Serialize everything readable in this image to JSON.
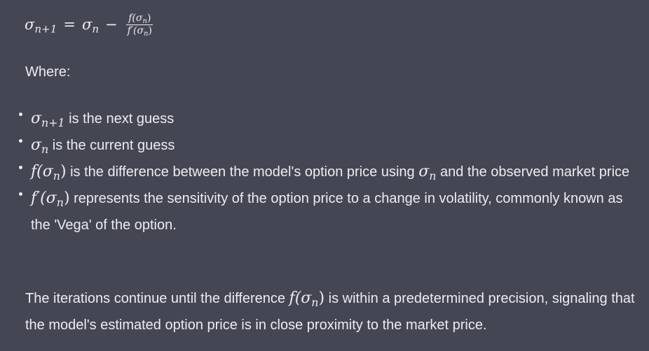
{
  "formula": {
    "lhs_symbol": "σ",
    "lhs_sub": "n+1",
    "equals": "=",
    "rhs_symbol": "σ",
    "rhs_sub": "n",
    "minus": "−",
    "numerator": "f(σ",
    "numerator_sub": "n",
    "numerator_close": ")",
    "denominator": "f′(σ",
    "denominator_sub": "n",
    "denominator_close": ")"
  },
  "where_label": "Where:",
  "bullets": [
    {
      "math_symbol": "σ",
      "math_sub": "n+1",
      "text": " is the next guess"
    },
    {
      "math_symbol": "σ",
      "math_sub": "n",
      "text": " is the current guess"
    },
    {
      "math_prefix": "f(σ",
      "math_sub": "n",
      "math_suffix": ")",
      "text_a": " is the difference between the model's option price using ",
      "inline_symbol": "σ",
      "inline_sub": "n",
      "text_b": " and the observed market price"
    },
    {
      "math_prefix": "f′(σ",
      "math_sub": "n",
      "math_suffix": ")",
      "text": " represents the sensitivity of the option price to a change in volatility, commonly known as the 'Vega' of the option."
    }
  ],
  "paragraph": {
    "text_a": "The iterations continue until the difference ",
    "math_prefix": "f(σ",
    "math_sub": "n",
    "math_suffix": ")",
    "text_b": " is within a predetermined precision, signaling that the model's estimated option price is in close proximity to the market price."
  }
}
